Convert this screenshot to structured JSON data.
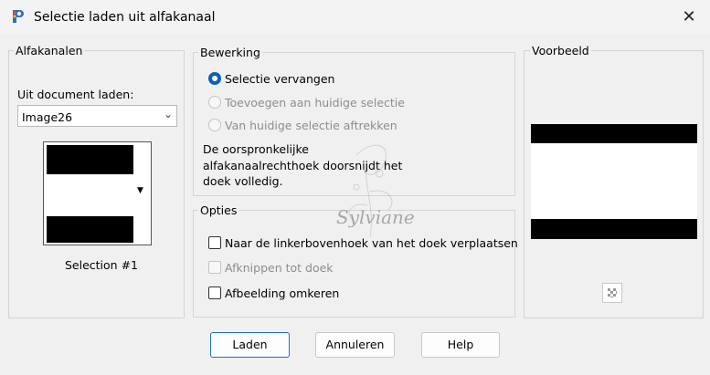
{
  "window": {
    "title": "Selectie laden uit alfakanaal",
    "close_glyph": "✕",
    "app_icon": "paintshop-icon"
  },
  "alfakanalen": {
    "legend": "Alfakanalen",
    "load_label": "Uit document laden:",
    "document_value": "Image26",
    "selection_caption": "Selection #1"
  },
  "bewerking": {
    "legend": "Bewerking",
    "options": [
      {
        "label": "Selectie vervangen",
        "selected": true,
        "disabled": false
      },
      {
        "label": "Toevoegen aan huidige selectie",
        "selected": false,
        "disabled": true
      },
      {
        "label": "Van huidige selectie aftrekken",
        "selected": false,
        "disabled": true
      }
    ],
    "info_lines": [
      "De oorspronkelijke",
      "alfakanaalrechthoek doorsnijdt het",
      "doek volledig."
    ]
  },
  "opties": {
    "legend": "Opties",
    "checks": [
      {
        "label": "Naar de linkerbovenhoek van het doek verplaatsen",
        "checked": false,
        "disabled": false
      },
      {
        "label": "Afknippen tot doek",
        "checked": false,
        "disabled": true
      },
      {
        "label": "Afbeelding omkeren",
        "checked": false,
        "disabled": false
      }
    ]
  },
  "voorbeeld": {
    "legend": "Voorbeeld"
  },
  "buttons": {
    "load": "Laden",
    "cancel": "Annuleren",
    "help": "Help"
  },
  "watermark": {
    "text": "Sylviane"
  },
  "colors": {
    "accent": "#0b61b8",
    "focus_border": "#1f6fd1"
  }
}
